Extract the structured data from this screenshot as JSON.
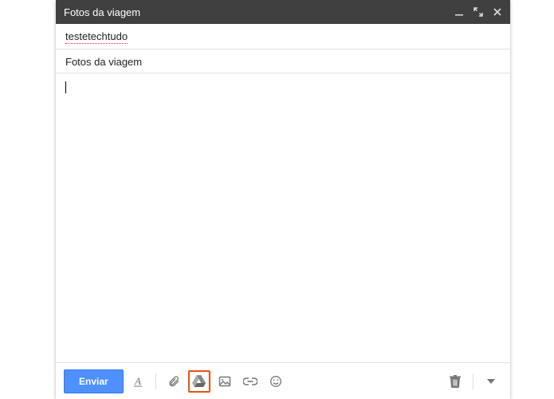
{
  "header": {
    "title": "Fotos da viagem"
  },
  "fields": {
    "recipient": "testetechtudo",
    "subject": "Fotos da viagem"
  },
  "body": "",
  "toolbar": {
    "send_label": "Enviar"
  }
}
